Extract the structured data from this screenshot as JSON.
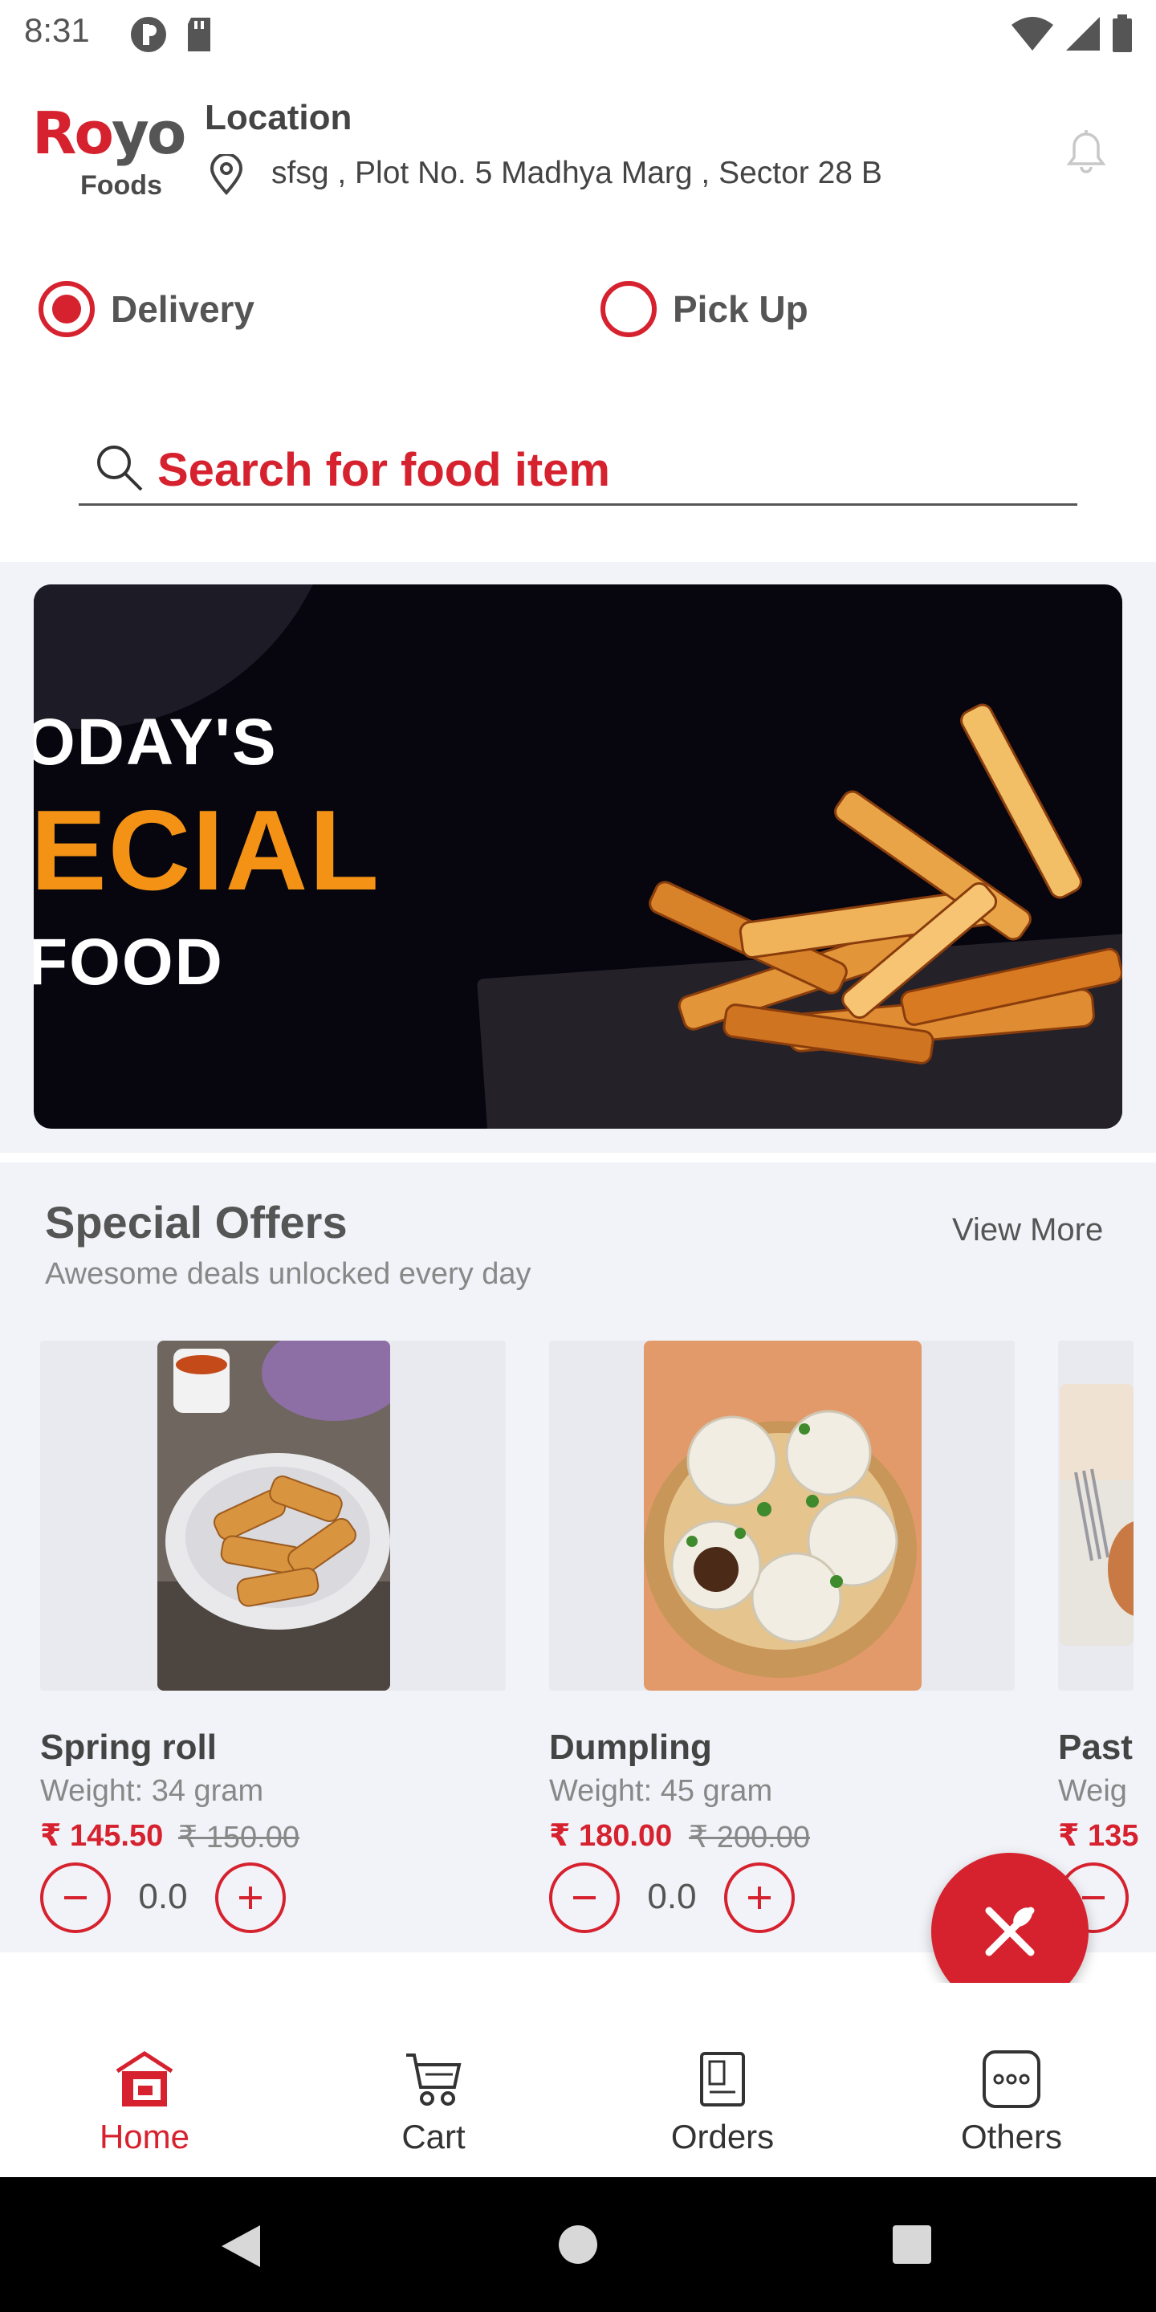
{
  "status_bar": {
    "time": "8:31"
  },
  "header": {
    "logo_main": "Royo",
    "logo_sub": "Foods",
    "location_title": "Location",
    "address": "sfsg , Plot No. 5 Madhya Marg , Sector 28 B"
  },
  "order_mode": {
    "delivery_label": "Delivery",
    "pickup_label": "Pick Up",
    "selected": "Delivery"
  },
  "search": {
    "placeholder": "Search for food item"
  },
  "banner": {
    "line1": "ODAY'S",
    "line2": "ECIAL",
    "line3": "FOOD"
  },
  "special_offers": {
    "title": "Special Offers",
    "subtitle": "Awesome deals unlocked every day",
    "view_more": "View More",
    "items": [
      {
        "name": "Spring roll",
        "weight": "Weight: 34 gram",
        "price": "₹ 145.50",
        "old_price": "₹ 150.00",
        "qty": "0.0"
      },
      {
        "name": "Dumpling",
        "weight": "Weight: 45 gram",
        "price": "₹ 180.00",
        "old_price": "₹ 200.00",
        "qty": "0.0"
      },
      {
        "name": "Past",
        "weight": "Weig",
        "price": "₹ 135"
      }
    ]
  },
  "bottom_nav": {
    "items": [
      {
        "label": "Home",
        "icon": "home-icon",
        "active": true
      },
      {
        "label": "Cart",
        "icon": "cart-icon",
        "active": false
      },
      {
        "label": "Orders",
        "icon": "orders-icon",
        "active": false
      },
      {
        "label": "Others",
        "icon": "more-icon",
        "active": false
      }
    ]
  },
  "colors": {
    "accent": "#d6222f",
    "banner_bg": "#07060f",
    "banner_orange": "#f39215",
    "section_bg": "#f2f3f8"
  }
}
